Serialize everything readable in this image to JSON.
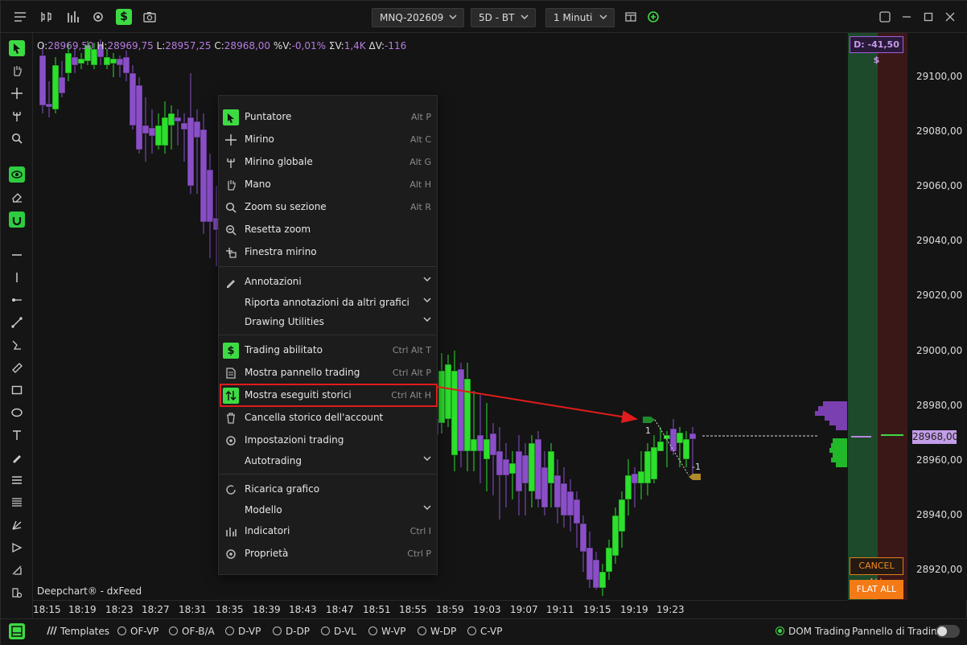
{
  "toolbar": {
    "symbol": "MNQ-202609",
    "period": "5D - BT",
    "timeframe": "1 Minuti",
    "icons": [
      "menu-icon",
      "bar-chart-icon",
      "histogram-icon",
      "gear-icon",
      "dollar-icon",
      "camera-icon",
      "layout-icon",
      "add-circle-icon"
    ]
  },
  "ohlc": {
    "o_label": "O:",
    "o": "28969,50",
    "h_label": "H:",
    "h": "28969,75",
    "l_label": "L:",
    "l": "28957,25",
    "c_label": "C:",
    "c": "28968,00",
    "pv_label": "%V:",
    "pv": "-0,01%",
    "sv_label": "ΣV:",
    "sv": "1,4K",
    "dv_label": "ΔV:",
    "dv": "-116"
  },
  "feed": "Deepchart® - dxFeed",
  "panel": {
    "pnl": "D: -41,50 $",
    "cancel_all": "CANCEL ALL",
    "flat_all": "FLAT ALL"
  },
  "y_axis": {
    "ticks": [
      "29100,00",
      "29080,00",
      "29060,00",
      "29040,00",
      "29020,00",
      "29000,00",
      "28980,00",
      "28960,00",
      "28940,00",
      "28920,00"
    ],
    "last": "28968,00"
  },
  "x_axis": {
    "ticks": [
      "18:15",
      "18:19",
      "18:23",
      "18:27",
      "18:31",
      "18:35",
      "18:39",
      "18:43",
      "18:47",
      "18:51",
      "18:55",
      "18:59",
      "19:03",
      "19:07",
      "19:11",
      "19:15",
      "19:19",
      "19:23"
    ]
  },
  "markers": {
    "buy": "1",
    "sell": "-1"
  },
  "context_menu": {
    "items": [
      {
        "label": "Puntatore",
        "shortcut": "Alt P",
        "icon": "pointer-icon"
      },
      {
        "label": "Mirino",
        "shortcut": "Alt C",
        "icon": "crosshair-icon"
      },
      {
        "label": "Mirino globale",
        "shortcut": "Alt G",
        "icon": "global-crosshair-icon"
      },
      {
        "label": "Mano",
        "shortcut": "Alt H",
        "icon": "hand-icon"
      },
      {
        "label": "Zoom su sezione",
        "shortcut": "Alt R",
        "icon": "zoom-icon"
      },
      {
        "label": "Resetta zoom",
        "shortcut": "",
        "icon": "zoom-reset-icon"
      },
      {
        "label": "Finestra mirino",
        "shortcut": "",
        "icon": "crosshair-window-icon"
      },
      {
        "label": "Annotazioni",
        "shortcut": "",
        "icon": "pencil-icon"
      },
      {
        "label": "Riporta annotazioni da altri grafici",
        "shortcut": "",
        "icon": ""
      },
      {
        "label": "Drawing Utilities",
        "shortcut": "",
        "icon": ""
      },
      {
        "label": "Trading abilitato",
        "shortcut": "Ctrl Alt T",
        "icon": "dollar-icon"
      },
      {
        "label": "Mostra pannello trading",
        "shortcut": "Ctrl Alt P",
        "icon": "document-icon"
      },
      {
        "label": "Mostra eseguiti storici",
        "shortcut": "Ctrl Alt H",
        "icon": "up-down-arrows-icon"
      },
      {
        "label": "Cancella storico dell'account",
        "shortcut": "",
        "icon": "trash-icon"
      },
      {
        "label": "Impostazioni trading",
        "shortcut": "",
        "icon": "gear-icon"
      },
      {
        "label": "Autotrading",
        "shortcut": "",
        "icon": ""
      },
      {
        "label": "Ricarica grafico",
        "shortcut": "",
        "icon": "reload-icon"
      },
      {
        "label": "Modello",
        "shortcut": "",
        "icon": ""
      },
      {
        "label": "Indicatori",
        "shortcut": "Ctrl I",
        "icon": "indicators-icon"
      },
      {
        "label": "Proprietà",
        "shortcut": "Ctrl P",
        "icon": "gear-icon"
      }
    ]
  },
  "bottom": {
    "templates": "Templates",
    "radios": [
      "OF-VP",
      "OF-B/A",
      "D-VP",
      "D-DP",
      "D-VL",
      "W-VP",
      "W-DP",
      "C-VP"
    ],
    "dom_trading": "DOM Trading",
    "trading_panel": "Pannello di Trading"
  },
  "colors": {
    "bull": "#2ce02c",
    "bear": "#8a4fc8",
    "accent": "#3ddb43",
    "highlight": "#e01c1c",
    "flat": "#f47a16"
  }
}
